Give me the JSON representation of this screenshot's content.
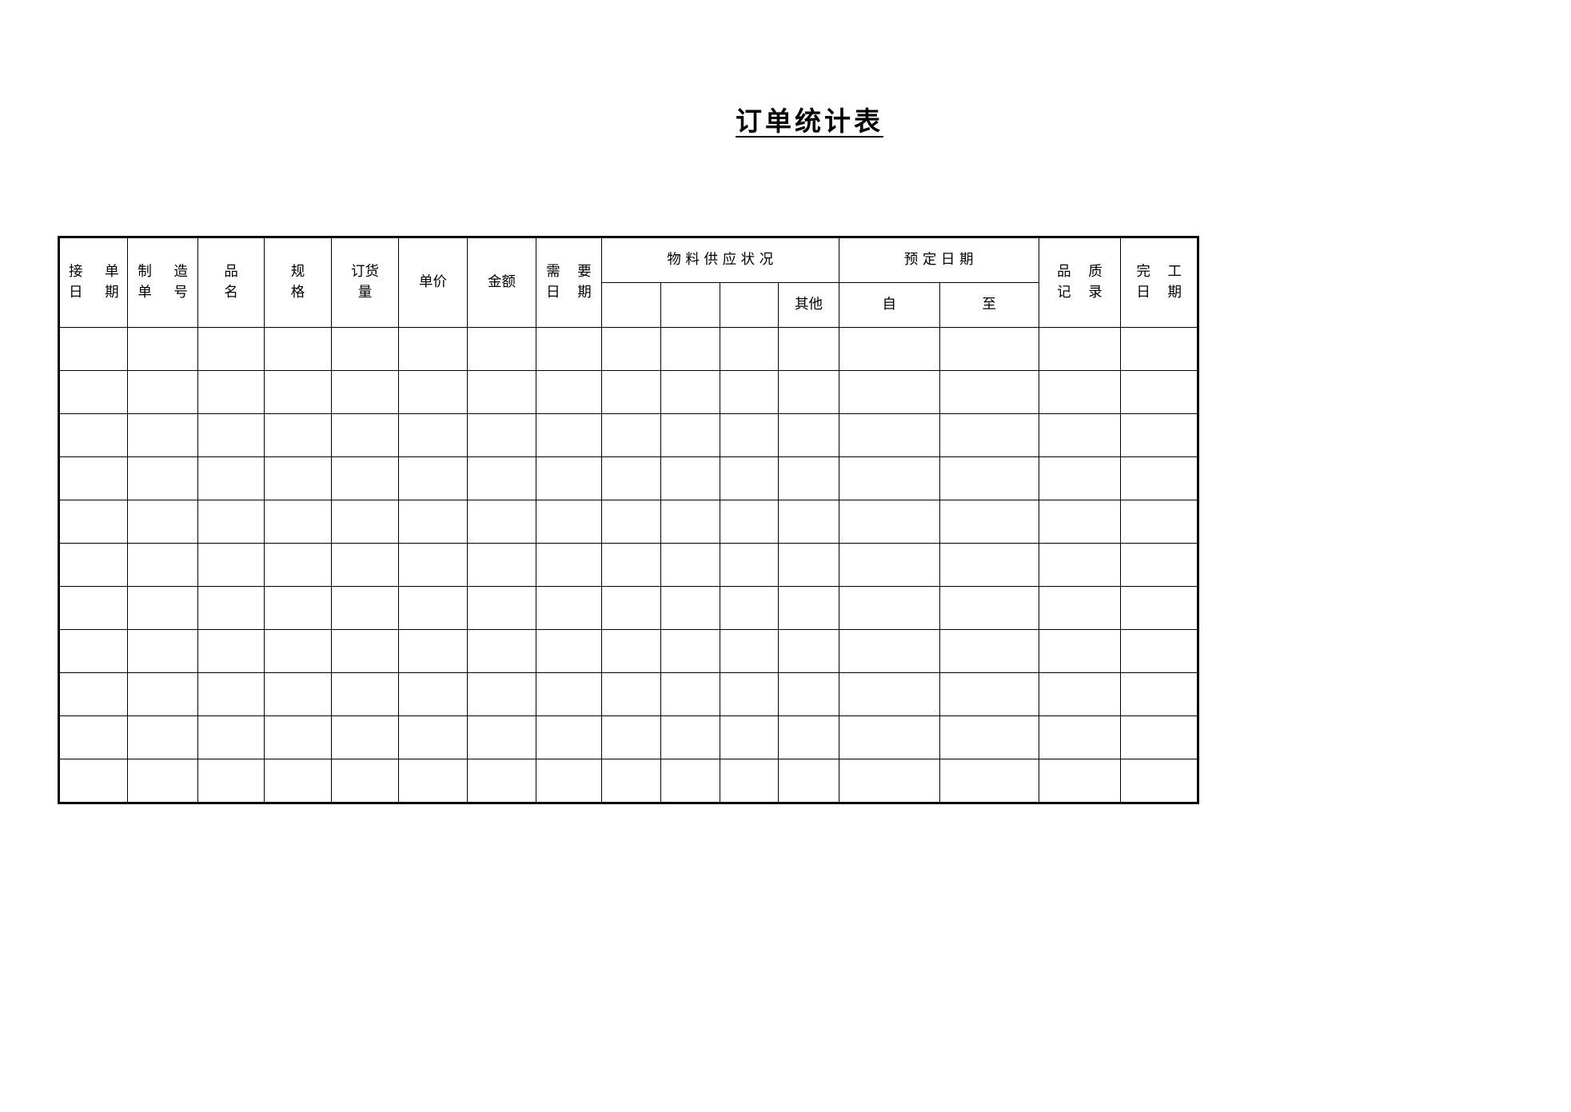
{
  "document": {
    "title": "订单统计表"
  },
  "table": {
    "header": {
      "group_row": [
        {
          "key": "order_date",
          "line1": "接 单",
          "line2": "日 期",
          "span": 1,
          "rows": 2
        },
        {
          "key": "mfg_order_no",
          "line1": "制 造",
          "line2": "单 号",
          "span": 1,
          "rows": 2
        },
        {
          "key": "product_name",
          "line1": "品",
          "line2": "名",
          "span": 1,
          "rows": 2
        },
        {
          "key": "spec",
          "line1": "规",
          "line2": "格",
          "span": 1,
          "rows": 2
        },
        {
          "key": "order_qty",
          "line1": "订货",
          "line2": "量",
          "span": 1,
          "rows": 2
        },
        {
          "key": "unit_price",
          "line1": "单价",
          "line2": "",
          "span": 1,
          "rows": 2
        },
        {
          "key": "amount",
          "line1": "金额",
          "line2": "",
          "span": 1,
          "rows": 2
        },
        {
          "key": "required_date",
          "line1": "需 要",
          "line2": "日 期",
          "span": 1,
          "rows": 2
        },
        {
          "key": "material_supply",
          "line1": "物 料 供 应 状 况",
          "line2": "",
          "span": 4,
          "rows": 1
        },
        {
          "key": "scheduled_date",
          "line1": "预 定 日 期",
          "line2": "",
          "span": 2,
          "rows": 1
        },
        {
          "key": "quality_record",
          "line1": "品 质",
          "line2": "记 录",
          "span": 1,
          "rows": 2
        },
        {
          "key": "finish_date",
          "line1": "完 工",
          "line2": "日 期",
          "span": 1,
          "rows": 2
        }
      ],
      "sub_row": [
        {
          "key": "material_1",
          "label": ""
        },
        {
          "key": "material_2",
          "label": ""
        },
        {
          "key": "material_3",
          "label": ""
        },
        {
          "key": "material_other",
          "label": "其他"
        },
        {
          "key": "scheduled_from",
          "label": "自"
        },
        {
          "key": "scheduled_to",
          "label": "至"
        }
      ]
    },
    "body": {
      "row_count": 11,
      "column_count": 16,
      "rows": [
        [
          "",
          "",
          "",
          "",
          "",
          "",
          "",
          "",
          "",
          "",
          "",
          "",
          "",
          "",
          "",
          ""
        ],
        [
          "",
          "",
          "",
          "",
          "",
          "",
          "",
          "",
          "",
          "",
          "",
          "",
          "",
          "",
          "",
          ""
        ],
        [
          "",
          "",
          "",
          "",
          "",
          "",
          "",
          "",
          "",
          "",
          "",
          "",
          "",
          "",
          "",
          ""
        ],
        [
          "",
          "",
          "",
          "",
          "",
          "",
          "",
          "",
          "",
          "",
          "",
          "",
          "",
          "",
          "",
          ""
        ],
        [
          "",
          "",
          "",
          "",
          "",
          "",
          "",
          "",
          "",
          "",
          "",
          "",
          "",
          "",
          "",
          ""
        ],
        [
          "",
          "",
          "",
          "",
          "",
          "",
          "",
          "",
          "",
          "",
          "",
          "",
          "",
          "",
          "",
          ""
        ],
        [
          "",
          "",
          "",
          "",
          "",
          "",
          "",
          "",
          "",
          "",
          "",
          "",
          "",
          "",
          "",
          ""
        ],
        [
          "",
          "",
          "",
          "",
          "",
          "",
          "",
          "",
          "",
          "",
          "",
          "",
          "",
          "",
          "",
          ""
        ],
        [
          "",
          "",
          "",
          "",
          "",
          "",
          "",
          "",
          "",
          "",
          "",
          "",
          "",
          "",
          "",
          ""
        ],
        [
          "",
          "",
          "",
          "",
          "",
          "",
          "",
          "",
          "",
          "",
          "",
          "",
          "",
          "",
          "",
          ""
        ],
        [
          "",
          "",
          "",
          "",
          "",
          "",
          "",
          "",
          "",
          "",
          "",
          "",
          "",
          "",
          "",
          ""
        ]
      ]
    }
  },
  "style": {
    "ink": "#000000",
    "paper": "#ffffff"
  }
}
